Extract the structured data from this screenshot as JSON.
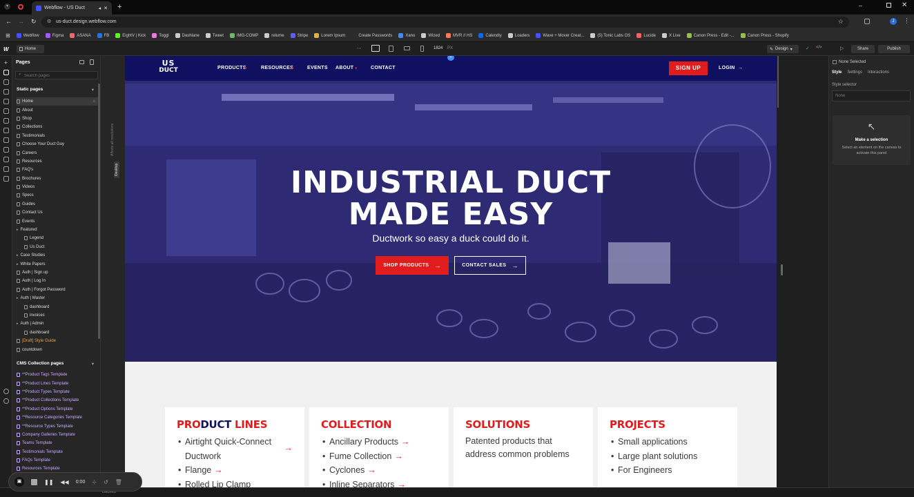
{
  "browser": {
    "tab_title": "Webflow - US Duct",
    "url": "us-duct.design.webflow.com"
  },
  "bookmarks": [
    {
      "label": "Webflow",
      "color": "#4353ff"
    },
    {
      "label": "Figma",
      "color": "#a259ff"
    },
    {
      "label": "ASANA",
      "color": "#f06a6a"
    },
    {
      "label": "FB",
      "color": "#1877f2"
    },
    {
      "label": "EightV | Kick",
      "color": "#53fc18"
    },
    {
      "label": "Toggl",
      "color": "#e57cd8"
    },
    {
      "label": "Dashlane",
      "color": "#cccccc"
    },
    {
      "label": "Tweet",
      "color": "#cccccc"
    },
    {
      "label": "IMG-COMP",
      "color": "#66bb66"
    },
    {
      "label": "relume",
      "color": "#cccccc"
    },
    {
      "label": "Stripe",
      "color": "#635bff"
    },
    {
      "label": "Lorem Ipsum",
      "color": "#e0b040"
    },
    {
      "label": "Create Passwords",
      "color": "#2b2b2b"
    },
    {
      "label": "Xano",
      "color": "#3f8cff"
    },
    {
      "label": "Wized",
      "color": "#cccccc"
    },
    {
      "label": "MVR // HS",
      "color": "#ff7a59"
    },
    {
      "label": "Calendly",
      "color": "#006bff"
    },
    {
      "label": "Loaders",
      "color": "#cccccc"
    },
    {
      "label": "Wave + Mover Creat...",
      "color": "#4353ff"
    },
    {
      "label": "(5) Tonic Labs OS",
      "color": "#cccccc"
    },
    {
      "label": "Lucide",
      "color": "#f56565"
    },
    {
      "label": "X Live",
      "color": "#cccccc"
    },
    {
      "label": "Canon Press - Edit -...",
      "color": "#95bf47"
    },
    {
      "label": "Canon Press - Shopify",
      "color": "#95bf47"
    }
  ],
  "designer": {
    "page_name": "Home",
    "width_value": "1824",
    "width_unit": "PX",
    "mode": "Design",
    "share": "Share",
    "publish": "Publish",
    "breakpoint_label": "Desktop",
    "affects_label": "Affects all resolutions"
  },
  "pages_panel": {
    "title": "Pages",
    "search_placeholder": "Search pages",
    "static_header": "Static pages",
    "cms_header": "CMS Collection pages",
    "static_pages": [
      {
        "label": "Home",
        "indent": 0,
        "folder": false
      },
      {
        "label": "About",
        "indent": 0,
        "folder": false
      },
      {
        "label": "Shop",
        "indent": 0,
        "folder": false
      },
      {
        "label": "Collections",
        "indent": 0,
        "folder": false
      },
      {
        "label": "Testimonials",
        "indent": 0,
        "folder": false
      },
      {
        "label": "Choose Your Duct Guy",
        "indent": 0,
        "folder": false
      },
      {
        "label": "Careers",
        "indent": 0,
        "folder": false
      },
      {
        "label": "Resources",
        "indent": 0,
        "folder": false
      },
      {
        "label": "FAQ's",
        "indent": 0,
        "folder": false
      },
      {
        "label": "Brochures",
        "indent": 0,
        "folder": false
      },
      {
        "label": "Videos",
        "indent": 0,
        "folder": false
      },
      {
        "label": "Specs",
        "indent": 0,
        "folder": false
      },
      {
        "label": "Guides",
        "indent": 0,
        "folder": false
      },
      {
        "label": "Contact Us",
        "indent": 0,
        "folder": false
      },
      {
        "label": "Events",
        "indent": 0,
        "folder": false
      },
      {
        "label": "Featured",
        "indent": 0,
        "folder": true
      },
      {
        "label": "Legend",
        "indent": 1,
        "folder": false
      },
      {
        "label": "Us Duct",
        "indent": 1,
        "folder": false
      },
      {
        "label": "Case Studies",
        "indent": 0,
        "folder": true
      },
      {
        "label": "White Papers",
        "indent": 0,
        "folder": true
      },
      {
        "label": "Auth | Sign up",
        "indent": 0,
        "folder": false
      },
      {
        "label": "Auth | Log In",
        "indent": 0,
        "folder": false
      },
      {
        "label": "Auth | Forgot Password",
        "indent": 0,
        "folder": false
      },
      {
        "label": "Auth | Master",
        "indent": 0,
        "folder": true
      },
      {
        "label": "dashboard",
        "indent": 1,
        "folder": false
      },
      {
        "label": "invoices",
        "indent": 1,
        "folder": false
      },
      {
        "label": "Auth | Admin",
        "indent": 0,
        "folder": true
      },
      {
        "label": "dashboard",
        "indent": 1,
        "folder": false
      },
      {
        "label": "[Draft] Style Guide",
        "indent": 0,
        "folder": false,
        "draft": true
      },
      {
        "label": "countdown",
        "indent": 0,
        "folder": false
      }
    ],
    "cms_pages": [
      "**Product Tags Template",
      "**Product Lines Template",
      "**Product Types Template",
      "**Product Collections Template",
      "**Product Options Template",
      "**Resource Categories Template",
      "**Resource Types Template",
      "Company Galleries Template",
      "Teams Template",
      "Testimonials Template",
      "FAQs Template",
      "Resources Template"
    ]
  },
  "site": {
    "logo_top": "US",
    "logo_bottom": "DUCT",
    "nav": [
      "PRODUCTS",
      "RESOURCES",
      "EVENTS",
      "ABOUT",
      "CONTACT"
    ],
    "signup": "SIGN UP",
    "login": "LOGIN",
    "hero_title_1": "INDUSTRIAL DUCT",
    "hero_title_2": "MADE EASY",
    "hero_sub": "Ductwork so easy a duck could do it.",
    "btn_shop": "SHOP PRODUCTS",
    "btn_contact": "CONTACT SALES",
    "cards": [
      {
        "title_a": "PRO",
        "title_b": "DUCT",
        "title_c": " LINES",
        "items": [
          "Airtight Quick-Connect Ductwork",
          "Flange",
          "Rolled Lip Clamp"
        ]
      },
      {
        "title": "COLLECTION",
        "items": [
          "Ancillary Products",
          "Fume Collection",
          "Cyclones",
          "Inline Separators"
        ]
      },
      {
        "title": "SOLUTIONS",
        "text": "Patented products that address common problems"
      },
      {
        "title": "PROJECTS",
        "items": [
          "Small applications",
          "Large plant solutions",
          "For Engineers"
        ]
      }
    ]
  },
  "right_panel": {
    "none_selected": "None Selected",
    "tabs": [
      "Style",
      "Settings",
      "Interactions"
    ],
    "style_selector": "Style selector",
    "selector_value": "None",
    "empty_title": "Make a selection",
    "empty_text": "Select an element on the canvas to activate this panel"
  },
  "recorder": {
    "time": "0:00"
  },
  "status": {
    "text": "Backed"
  },
  "colors": {
    "navy": "#0f1160",
    "red": "#e01c1c",
    "hero": "#2f2b78"
  }
}
